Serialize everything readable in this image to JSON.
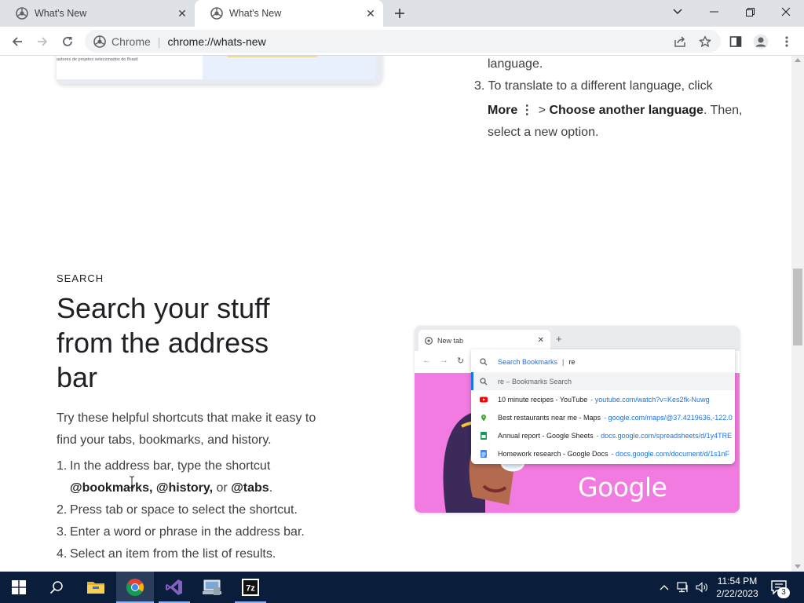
{
  "browser": {
    "tabs": [
      {
        "title": "What's New",
        "active": false
      },
      {
        "title": "What's New",
        "active": true
      }
    ],
    "omnibox": {
      "site_label": "Chrome",
      "url": "chrome://whats-new"
    }
  },
  "top_card": {
    "caption": "autores de projetos selecionados do Brasil"
  },
  "translate_steps": {
    "line_language": "language.",
    "step3_num": "3.",
    "step3_line1": "To translate to a different language, click",
    "more": "More",
    "more_icon": "⋮",
    "gt": " > ",
    "choose": "Choose another language",
    "then": ". Then,",
    "line3": "select a new option."
  },
  "search_section": {
    "eyebrow": "SEARCH",
    "headline": "Search your stuff from the address bar",
    "intro": "Try these helpful shortcuts that make it easy to find your tabs, bookmarks, and history.",
    "steps": [
      {
        "num": "1.",
        "text": "In the address bar, type the shortcut"
      },
      {
        "num": "",
        "bold1": "@bookmarks, @history,",
        "mid": " or ",
        "bold2": "@tabs",
        "end": "."
      },
      {
        "num": "2.",
        "text": "Press tab or space to select the shortcut."
      },
      {
        "num": "3.",
        "text": "Enter a word or phrase in the address bar."
      },
      {
        "num": "4.",
        "text": "Select an item from the list of results."
      }
    ]
  },
  "illustration": {
    "tab_title": "New tab",
    "omnibox_chip": "Search Bookmarks",
    "omnibox_typed": "re",
    "brand_text": "Google",
    "rows": [
      {
        "icon": "search-icon",
        "label": "Search Bookmarks  |  re",
        "url": ""
      },
      {
        "icon": "search-icon",
        "label": "re – Bookmarks Search",
        "url": ""
      },
      {
        "icon": "youtube-icon",
        "label": "10 minute recipes - YouTube",
        "url": "- youtube.com/watch?v=Kes2fk-Nuwg"
      },
      {
        "icon": "maps-pin-icon",
        "label": "Best restaurants near me - Maps",
        "url": "- google.com/maps/@37.4219636,-122.0"
      },
      {
        "icon": "sheets-icon",
        "label": "Annual report - Google Sheets",
        "url": "- docs.google.com/spreadsheets/d/1y4TRE"
      },
      {
        "icon": "docs-icon",
        "label": "Homework research - Google Docs",
        "url": "- docs.google.com/document/d/1s1nF"
      }
    ]
  },
  "taskbar": {
    "clock_time": "11:54 PM",
    "clock_date": "2/22/2023",
    "notification_count": "3",
    "apps": [
      "file-explorer-icon",
      "chrome-icon",
      "visual-studio-icon",
      "computer-management-icon",
      "seven-zip-icon"
    ],
    "seven_zip_label": "7z"
  },
  "colors": {
    "accent": "#1a73e8",
    "tabstrip": "#dee1e6",
    "taskbar": "#0a1d3a",
    "illustration_pink": "#f17be0"
  }
}
